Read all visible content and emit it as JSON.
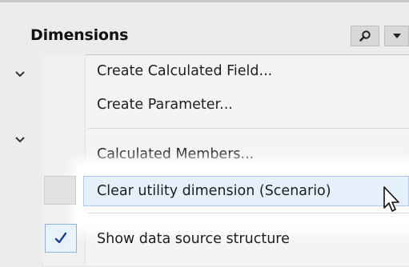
{
  "panel": {
    "title": "Dimensions",
    "search_icon": "search-icon",
    "dropdown_icon": "caret-down-icon"
  },
  "menu": {
    "items": [
      {
        "label": "Create Calculated Field..."
      },
      {
        "label": "Create Parameter..."
      },
      {
        "label": "Calculated Members..."
      },
      {
        "label": "Clear utility dimension (Scenario)",
        "state": "hovered"
      },
      {
        "label": "Show data source structure",
        "checked": true
      }
    ]
  },
  "colors": {
    "highlight_fill": "#e6f0fb",
    "highlight_border": "#a9c8ee",
    "check_color": "#1f3f8f"
  }
}
